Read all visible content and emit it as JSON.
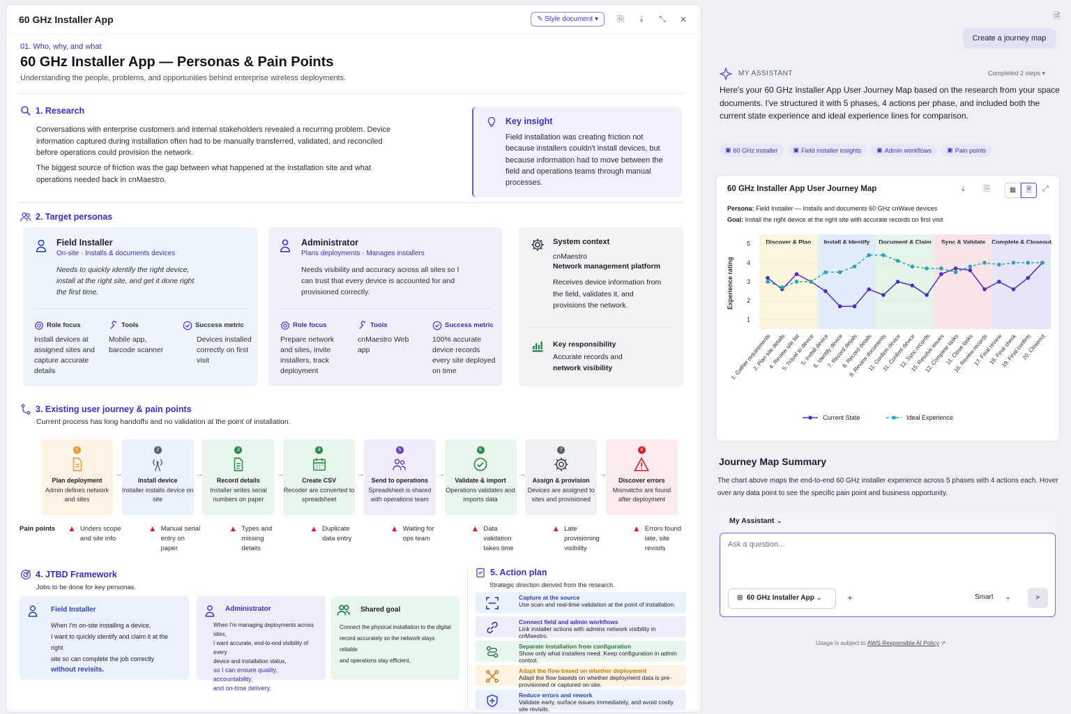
{
  "app_title": "60 GHz Installer App",
  "toolbar": {
    "style_label": "Style document"
  },
  "header": {
    "eyebrow": "01. Who, why, and what",
    "title": "60 GHz Installer App — Personas & Pain Points",
    "subtitle": "Understanding the people, problems, and opportunities behind enterprise wireless deployments."
  },
  "research": {
    "heading": "1. Research",
    "p1": "Conversations with enterprise customers and internal stakeholders revealed a recurring problem. Device information captured during installation often had to be manually transferred, validated, and reconciled before operations could provision the network.",
    "p2": "The biggest source of friction was the gap between what happened at the installation site and what operations needed back in cnMaestro."
  },
  "insight": {
    "title": "Key insight",
    "text": "Field installation was creating friction not because installers couldn't install devices, but because information had to move between the field and operations teams through manual processes."
  },
  "personas": {
    "heading": "2. Target personas",
    "field": {
      "name": "Field Installer",
      "sub": "On-site · Installs & documents devices",
      "desc": "Needs to quickly identify the right device, install at the right site, and get it done right the first time.",
      "role_h": "Role focus",
      "role": "Install devices at assigned sites and capture accurate details",
      "tools_h": "Tools",
      "tools": "Mobile app, barcode scanner",
      "metric_h": "Success metric",
      "metric": "Devices installed correctly on first visit"
    },
    "admin": {
      "name": "Administrator",
      "sub": "Plans deployments · Manages installers",
      "desc": "Needs visibility and accuracy across all sites so I can trust that every device is accounted for and provisioned correctly.",
      "role_h": "Role focus",
      "role": "Prepare network and sites, invite installers, track deployment",
      "tools_h": "Tools",
      "tools": "cnMaestro Web app",
      "metric_h": "Success metric",
      "metric": "100% accurate device records every site deployed on time"
    },
    "system": {
      "title": "System context",
      "name": "cnMaestro",
      "name2": "Network management platform",
      "desc": "Receives device information from the field, validates it, and provisions the network.",
      "kr_h": "Key responsibility",
      "kr1": "Accurate records and",
      "kr2": "network visibility"
    }
  },
  "journey": {
    "heading": "3. Existing user journey & pain points",
    "sub": "Current process has long handoffs and no validation at the point of installation.",
    "pain_label": "Pain points",
    "steps": [
      {
        "n": "1",
        "title": "Plan deployment",
        "desc": "Admin defines network and sites",
        "pain": "Unders scope and site info",
        "color": "#fcf3e4",
        "nc": "#e39b3a",
        "icon": "doc"
      },
      {
        "n": "2",
        "title": "Install device",
        "desc": "Installer installs device on site",
        "pain": "Manual serial entry on paper",
        "color": "#eaf2fb",
        "nc": "#5b5e6b",
        "icon": "tower"
      },
      {
        "n": "3",
        "title": "Record details",
        "desc": "Installer writes serial numbers on paper",
        "pain": "Types and missing details",
        "color": "#e9f6ee",
        "nc": "#2e8a4c",
        "icon": "paper"
      },
      {
        "n": "4",
        "title": "Create CSV",
        "desc": "Recoder are converted to spreadsheet",
        "pain": "Duplicate data entry",
        "color": "#e9f6ee",
        "nc": "#2e8a4c",
        "icon": "calendar"
      },
      {
        "n": "5",
        "title": "Send to operations",
        "desc": "Spreadsheet is shared with operations team",
        "pain": "Waiting for ops team",
        "color": "#f1ecfb",
        "nc": "#6b3fc7",
        "icon": "people"
      },
      {
        "n": "6",
        "title": "Validate & import",
        "desc": "Operations validates and imports data",
        "pain": "Data validation takes time",
        "color": "#e9f6ee",
        "nc": "#2e8a4c",
        "icon": "check"
      },
      {
        "n": "7",
        "title": "Assign & provision",
        "desc": "Devices are assigned to sites and provisioned",
        "pain": "Late provisioning visibility",
        "color": "#eef0f4",
        "nc": "#5b5e6b",
        "icon": "gear"
      },
      {
        "n": "8",
        "title": "Discover errors",
        "desc": "Mismatchs are found after deployment",
        "pain": "Errors found late, site revisits",
        "color": "#fcebec",
        "nc": "#d5232b",
        "icon": "alert"
      }
    ]
  },
  "jtbd": {
    "heading": "4. JTBD Framework",
    "sub": "Jobs to be done for key personas.",
    "field": {
      "title": "Field Installer",
      "l1": "When I'm on-site installing a device,",
      "l2": "I want to quickly identify and claim it at the right",
      "l3": "site so can complete the job correctly",
      "l4": "without revisits."
    },
    "admin": {
      "title": "Administrator",
      "l1": "When I'm managing deployments across sites,",
      "l2": "I want accurate, end-to-end visibility of every",
      "l3": "device and installation status,",
      "l4": "so I can ensure quality, accountability,",
      "l5": "and on-time delivery."
    },
    "shared": {
      "title": "Shared goal",
      "l1": "Connect the physical installation to the digital",
      "l2": "record accurately so the network stays reliable",
      "l3": "and operations stay efficient."
    }
  },
  "action": {
    "heading": "5. Action plan",
    "sub": "Strategic direction derived from the research.",
    "items": [
      {
        "t": "Capture at the source",
        "d": "Use scan and real-time validation at the point of installation.",
        "bg": "#eaf1fb",
        "tc": "#2c43b8",
        "icon": "scan"
      },
      {
        "t": "Connect field and admin workflows",
        "d": "Link installer actions with admins network visibility in cnMaestro.",
        "bg": "#f0ecfa",
        "tc": "#3a30b8",
        "icon": "link"
      },
      {
        "t": "Separate installation from configuration",
        "d": "Show only what installers need. Keep configuration in admin control.",
        "bg": "#e9f6ee",
        "tc": "#1f7a43",
        "icon": "split"
      },
      {
        "t": "Adapt the flow based on whether deployment",
        "d": "Adapt the flow baseds on whether deployment data is pre-provisioned or captured on-site.",
        "bg": "#fcf3e4",
        "tc": "#c77a16",
        "icon": "flow"
      },
      {
        "t": "Reduce errors and rework",
        "d": "Validate early, surface issues immediately, and avoid costly site revisits.",
        "bg": "#eaf1fb",
        "tc": "#2c43b8",
        "icon": "shield"
      }
    ]
  },
  "assistant": {
    "create_label": "Create a journey map",
    "label": "MY ASSISTANT",
    "completed": "Completed 2 steps",
    "message": "Here's your 60 GHz Installer App User Journey Map based on the research from your space documents. I've structured it with 5 phases, 4 actions per phase, and included both the current state experience and ideal experience lines for comparison.",
    "chips": [
      "60 GHz installer",
      "Field installer insights",
      "Admin workflows",
      "Pain points"
    ],
    "summary_title": "Journey Map Summary",
    "summary": "The chart above maps the end-to-end 60 GHz installer experience across 5 phases with 4 actions each. Hover over any data point to see the specific pain point and business opportunity.",
    "selector": "My Assistant",
    "placeholder": "Ask a question...",
    "context": "60 GHz Installer App",
    "mode": "Smart",
    "footer_pre": "Usage is subject to",
    "footer_link": "AWS Responsible AI Policy"
  },
  "chart_data": {
    "type": "line",
    "title": "60 GHz Installer App User Journey Map",
    "persona_label": "Persona:",
    "persona": "Field Installer — Installs and documents 60 GHz cnWave devices",
    "goal_label": "Goal:",
    "goal": "Install the right device at the right site with accurate records on first visit",
    "ylabel": "Experience rating",
    "ylim": [
      0.5,
      5.5
    ],
    "yticks": [
      1,
      2,
      3,
      4,
      5
    ],
    "phases": [
      {
        "name": "Discover & Plan",
        "color": "#fbf5dc"
      },
      {
        "name": "Install & Identify",
        "color": "#e3ecfb"
      },
      {
        "name": "Document & Claim",
        "color": "#e4f4e8"
      },
      {
        "name": "Sync & Validate",
        "color": "#fbe4e8"
      },
      {
        "name": "Complete & Closeout",
        "color": "#e6e6f8"
      }
    ],
    "categories": [
      "1. Gather requirements",
      "2. Plan site details",
      "4. Review site list",
      "5. Travel to device",
      "5. Install device",
      "6. Identify device",
      "7. Record details",
      "8. Record details",
      "8. Review documents",
      "11. Confirm device",
      "11. Confirm device",
      "12. Sync records",
      "15. Resolve issues",
      "12. Complete tasks",
      "11. Close tasks",
      "16. Review records",
      "17. Final review",
      "18. Final check",
      "19. Final confirm",
      "20. Closeout"
    ],
    "series": [
      {
        "name": "Current State",
        "color": "#4a2fc4",
        "values": [
          3.2,
          2.6,
          3.4,
          3.0,
          2.5,
          1.7,
          1.7,
          2.6,
          2.3,
          3.0,
          2.8,
          2.3,
          3.4,
          3.7,
          3.6,
          2.6,
          3.0,
          2.6,
          3.2,
          4.0
        ]
      },
      {
        "name": "Ideal Experience",
        "color": "#2aa3b5",
        "values": [
          3.0,
          2.7,
          3.0,
          3.0,
          3.5,
          3.5,
          3.8,
          4.4,
          4.4,
          4.1,
          3.8,
          3.7,
          3.7,
          3.5,
          3.8,
          4.0,
          3.9,
          4.0,
          4.0,
          4.0
        ]
      }
    ]
  }
}
